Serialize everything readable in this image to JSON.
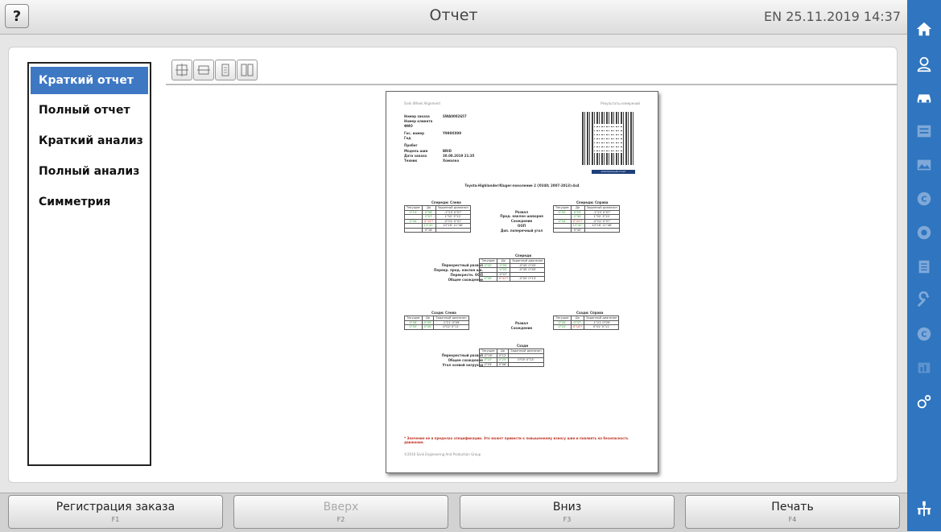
{
  "header": {
    "help_label": "?",
    "title": "Отчет",
    "status": "EN 25.11.2019 14:37"
  },
  "menu": {
    "items": [
      {
        "label": "Краткий отчет",
        "active": true
      },
      {
        "label": "Полный отчет",
        "active": false
      },
      {
        "label": "Краткий анализ",
        "active": false
      },
      {
        "label": "Полный анализ",
        "active": false
      },
      {
        "label": "Симметрия",
        "active": false
      }
    ]
  },
  "toolbar": {
    "icons": [
      "fit-page-icon",
      "fit-width-icon",
      "single-page-icon",
      "two-pages-icon"
    ]
  },
  "sidebar_icons": [
    "home-icon",
    "user-icon",
    "car-icon",
    "list-icon",
    "map-icon",
    "c-icon",
    "gauge-icon",
    "clipboard-icon",
    "wrench-icon",
    "settings-icon",
    "chart-icon",
    "gears-icon",
    "network-icon"
  ],
  "report": {
    "header_left": "Sivik Wheel Alignment",
    "header_right": "Результаты измерений",
    "fields": [
      [
        "Номер заказа",
        "SWA0002657"
      ],
      [
        "Номер клиента",
        ""
      ],
      [
        "ФИО",
        ""
      ],
      [
        "Гос. номер",
        "Y999XX99"
      ],
      [
        "Год",
        ""
      ],
      [
        "Пробег",
        ""
      ],
      [
        "Модель шин",
        "BRID"
      ],
      [
        "Дата заказа",
        "30.08.2019 21:35"
      ],
      [
        "Техник",
        "Хомалко"
      ]
    ],
    "badge": "электронный отчет",
    "vehicle": "Toyota›Highlander/Kluger›поколение 2 (XU40; 2007-2013)›4x4",
    "front_left_title": "Спереди: Слева",
    "front_right_title": "Спереди: Справа",
    "front_title": "Спереди",
    "rear_left_title": "Сзади: Слева",
    "rear_right_title": "Сзади: Справа",
    "rear_title": "Сзади",
    "col_current": "Текущие",
    "col_before": "До",
    "col_range": "Заданный диапазон",
    "front_params": [
      "Развал",
      "Прод. наклон шкворня",
      "Схождение",
      "ООП",
      "Доп. поперечный угол"
    ],
    "front_cross_params": [
      "Перекрестный развал",
      "Перекр. прод. наклон шв.",
      "Перекрестн. ООП",
      "Общее схождение"
    ],
    "rear_params": [
      "Развал",
      "Схождение"
    ],
    "rear_cross_params": [
      "Перекрестный развал",
      "Общее схождение",
      "Угол осевой нагрузки"
    ],
    "warning": "* Значение не в пределах спецификации. Это может привести к повышенному износу шин и повлиять на безопасность движения.",
    "footer": "©2016 Sivik Engineering And Production Group"
  },
  "footer_buttons": [
    {
      "label": "Регистрация заказа",
      "key": "F1",
      "enabled": true
    },
    {
      "label": "Вверх",
      "key": "F2",
      "enabled": false
    },
    {
      "label": "Вниз",
      "key": "F3",
      "enabled": true
    },
    {
      "label": "Печать",
      "key": "F4",
      "enabled": true
    }
  ]
}
